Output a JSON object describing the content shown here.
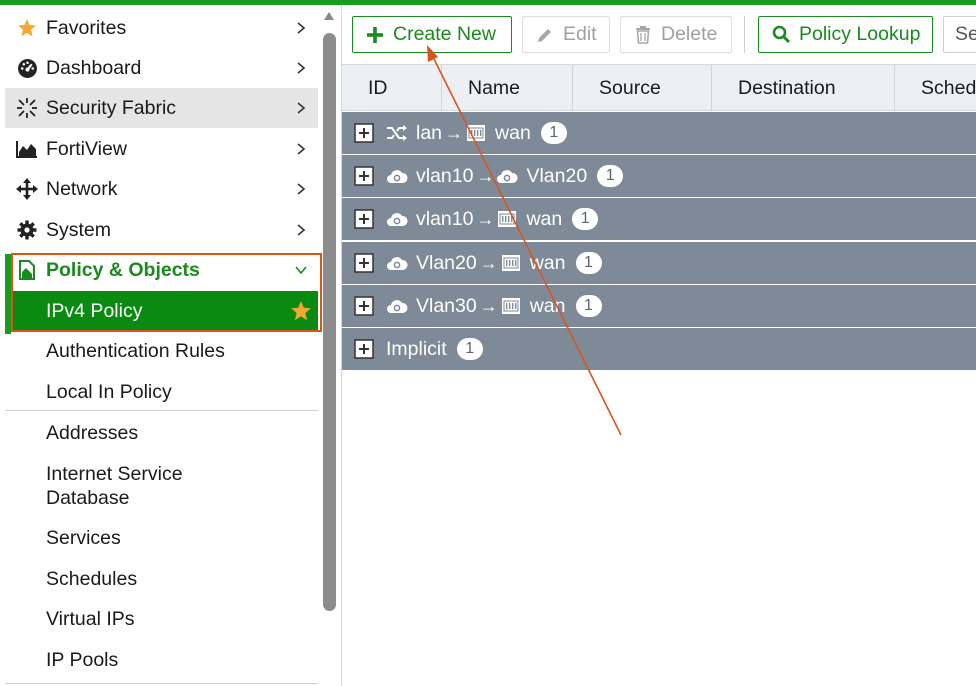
{
  "sidebar": {
    "items": [
      {
        "label": "Favorites",
        "icon": "star-icon"
      },
      {
        "label": "Dashboard",
        "icon": "dashboard-icon"
      },
      {
        "label": "Security Fabric",
        "icon": "security-fabric-icon"
      },
      {
        "label": "FortiView",
        "icon": "fortiview-chart-icon"
      },
      {
        "label": "Network",
        "icon": "network-move-icon"
      },
      {
        "label": "System",
        "icon": "gear-icon"
      },
      {
        "label": "Policy & Objects",
        "icon": "policy-document-icon"
      }
    ],
    "active_item": {
      "label": "IPv4 Policy",
      "favorite_icon": "star-icon"
    },
    "subitems": [
      "Authentication Rules",
      "Local In Policy",
      "Addresses",
      "Internet Service Database",
      "Services",
      "Schedules",
      "Virtual IPs",
      "IP Pools"
    ]
  },
  "toolbar": {
    "create_new": "Create New",
    "edit": "Edit",
    "delete": "Delete",
    "policy_lookup": "Policy Lookup",
    "search_placeholder": "Se"
  },
  "table": {
    "columns": [
      "ID",
      "Name",
      "Source",
      "Destination",
      "Schedu"
    ],
    "groups": [
      {
        "src_icon": "shuffle-icon",
        "src": "lan",
        "arrow": "→",
        "dst_icon": "port-icon",
        "dst": "wan",
        "count": "1"
      },
      {
        "src_icon": "cloud-icon",
        "src": "vlan10",
        "arrow": "→",
        "dst_icon": "cloud-icon",
        "dst": "Vlan20",
        "count": "1"
      },
      {
        "src_icon": "cloud-icon",
        "src": "vlan10",
        "arrow": "→",
        "dst_icon": "port-icon",
        "dst": "wan",
        "count": "1"
      },
      {
        "src_icon": "cloud-icon",
        "src": "Vlan20",
        "arrow": "→",
        "dst_icon": "port-icon",
        "dst": "wan",
        "count": "1"
      },
      {
        "src_icon": "cloud-icon",
        "src": "Vlan30",
        "arrow": "→",
        "dst_icon": "port-icon",
        "dst": "wan",
        "count": "1"
      },
      {
        "src_icon": "",
        "src": "Implicit",
        "arrow": "",
        "dst_icon": "",
        "dst": "",
        "count": "1"
      }
    ]
  },
  "colors": {
    "brand_green": "#1a9d1f",
    "active_green": "#0a8a10",
    "group_row": "#7e8a98",
    "annotation": "#d9541c",
    "favorite_star": "#f0a830"
  }
}
